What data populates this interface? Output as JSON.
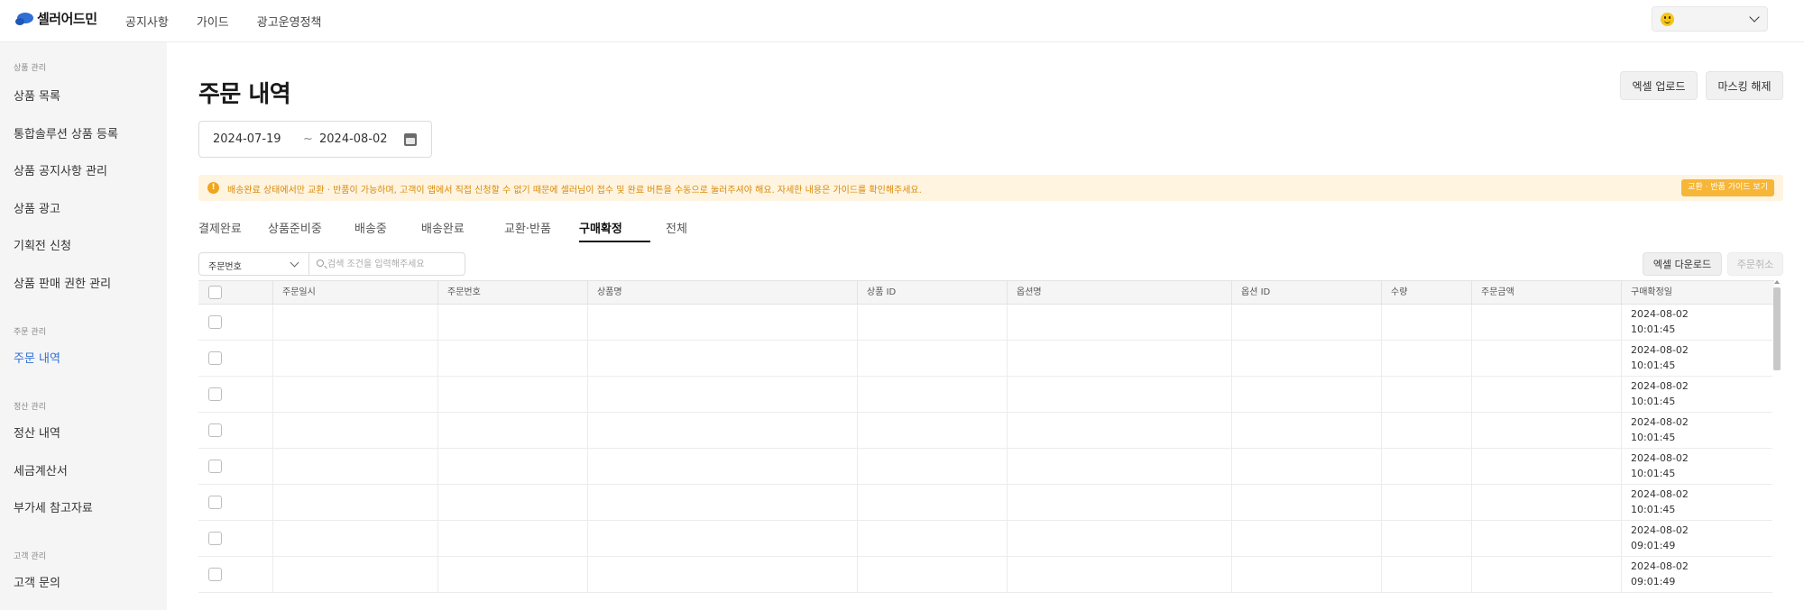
{
  "header": {
    "logo_text": "셀러어드민",
    "nav": [
      "공지사항",
      "가이드",
      "광고운영정책"
    ],
    "profile_icon": "smiley-icon",
    "brand_color": "#2f6fd6"
  },
  "sidebar": {
    "sections": [
      {
        "title": "상품 관리",
        "items": [
          "상품 목록",
          "통합솔루션 상품 등록",
          "상품 공지사항 관리",
          "상품 광고",
          "기획전 신청",
          "상품 판매 권한 관리"
        ]
      },
      {
        "title": "주문 관리",
        "items": [
          "주문 내역"
        ]
      },
      {
        "title": "정산 관리",
        "items": [
          "정산 내역",
          "세금계산서",
          "부가세 참고자료"
        ]
      },
      {
        "title": "고객 관리",
        "items": [
          "고객 문의"
        ]
      }
    ],
    "active_item": "주문 내역"
  },
  "main": {
    "title": "주문 내역",
    "buttons": {
      "excel_upload": "엑셀 업로드",
      "unmask": "마스킹 해제"
    },
    "date_range": {
      "start": "2024-07-19",
      "separator": "~",
      "end": "2024-08-02"
    },
    "notice": {
      "text": "배송완료 상태에서만 교환 · 반품이 가능하며, 고객이 앱에서 직접 신청할 수 없기 때문에 셀러님이 접수 및 완료 버튼을 수동으로 눌러주셔야 해요. 자세한 내용은 가이드를 확인해주세요.",
      "guide_button": "교환 · 반품 가이드 보기",
      "color": "#d98a0a",
      "background": "#fff4e0"
    },
    "tabs": [
      "결제완료",
      "상품준비중",
      "배송중",
      "배송완료",
      "교환·반품",
      "구매확정",
      "전체"
    ],
    "active_tab": "구매확정",
    "filter": {
      "select_value": "주문번호",
      "search_placeholder": "검색 조건을 입력해주세요",
      "excel_download": "엑셀 다운로드",
      "cancel_order": "주문취소"
    },
    "table": {
      "columns": [
        "",
        "주문일시",
        "주문번호",
        "상품명",
        "상품 ID",
        "옵션명",
        "옵션 ID",
        "수량",
        "주문금액",
        "구매확정일"
      ],
      "rows": [
        {
          "confirm_date": "2024-08-02",
          "confirm_time": "10:01:45"
        },
        {
          "confirm_date": "2024-08-02",
          "confirm_time": "10:01:45"
        },
        {
          "confirm_date": "2024-08-02",
          "confirm_time": "10:01:45"
        },
        {
          "confirm_date": "2024-08-02",
          "confirm_time": "10:01:45"
        },
        {
          "confirm_date": "2024-08-02",
          "confirm_time": "10:01:45"
        },
        {
          "confirm_date": "2024-08-02",
          "confirm_time": "10:01:45"
        },
        {
          "confirm_date": "2024-08-02",
          "confirm_time": "09:01:49"
        },
        {
          "confirm_date": "2024-08-02",
          "confirm_time": "09:01:49"
        }
      ]
    }
  }
}
